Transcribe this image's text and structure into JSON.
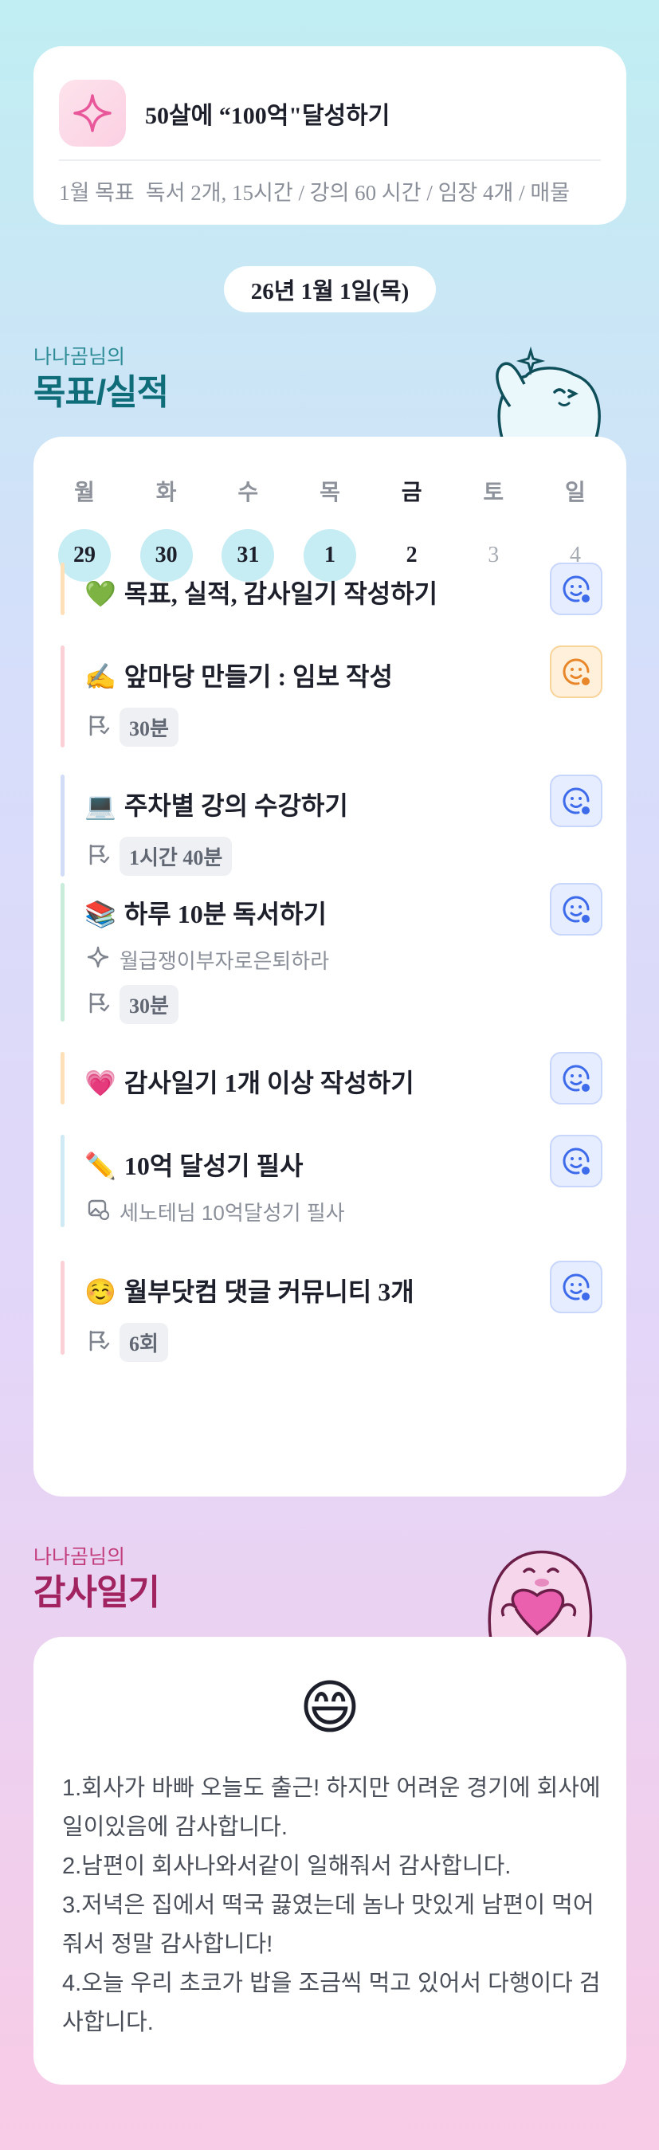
{
  "goal": {
    "title": "50살에 “100억\"달성하기",
    "month_label": "1월 목표",
    "summary": "독서 2개, 15시간 / 강의 60 시간 / 임장 4개 / 매물"
  },
  "date": "26년 1월 1일(목)",
  "goals_section": {
    "owner": "나나곰님의",
    "title": "목표/실적"
  },
  "week": [
    {
      "name": "월",
      "num": "29",
      "state": "done"
    },
    {
      "name": "화",
      "num": "30",
      "state": "done"
    },
    {
      "name": "수",
      "num": "31",
      "state": "done"
    },
    {
      "name": "목",
      "num": "1",
      "state": "done"
    },
    {
      "name": "금",
      "num": "2",
      "state": "today"
    },
    {
      "name": "토",
      "num": "3",
      "state": "future"
    },
    {
      "name": "일",
      "num": "4",
      "state": "future"
    }
  ],
  "tasks": [
    {
      "emoji": "💚",
      "title": "목표, 실적, 감사일기 작성하기",
      "duration": "",
      "note": "",
      "bar_color": "#fde0b8",
      "face": "blue"
    },
    {
      "emoji": "✍️",
      "title": "앞마당 만들기 : 임보 작성",
      "duration": "30분",
      "note": "",
      "bar_color": "#fbd0d6",
      "face": "orange"
    },
    {
      "emoji": "💻",
      "title": "주차별 강의 수강하기",
      "duration": "1시간 40분",
      "note": "",
      "bar_color": "#d1dcf7",
      "face": "blue"
    },
    {
      "emoji": "📚",
      "title": "하루 10분 독서하기",
      "duration": "30분",
      "note": "월급쟁이부자로은퇴하라",
      "bar_color": "#c8ecd9",
      "face": "blue"
    },
    {
      "emoji": "💗",
      "title": "감사일기 1개 이상 작성하기",
      "duration": "",
      "note": "",
      "bar_color": "#fde0b8",
      "face": "blue"
    },
    {
      "emoji": "✏️",
      "title": "10억 달성기 필사",
      "duration": "",
      "note": "세노테님 10억달성기 필사",
      "bar_color": "#cfeaf4",
      "face": "blue"
    },
    {
      "emoji": "☺️",
      "title": "월부닷컴 댓글 커뮤니티 3개",
      "duration": "6회",
      "note": "",
      "bar_color": "#fbd0d6",
      "face": "blue"
    }
  ],
  "gratitude_section": {
    "owner": "나나곰님의",
    "title": "감사일기"
  },
  "gratitude": {
    "emoji": "😄",
    "lines": [
      "1.회사가 바빠 오늘도 출근! 하지만 어려운 경기에 회사에 일이있음에 감사합니다.",
      "2.남편이 회사나와서같이 일해줘서 감사합니다.",
      "3.저녁은 집에서 떡국 끓였는데 놈나 맛있게 남편이 먹어줘서 정말 감사합니다!",
      "4.오늘 우리 초코가 밥을 조금씩 먹고 있어서 다행이다 검사합니다."
    ]
  },
  "colors": {
    "done_day": "#c6ecf4",
    "face_blue": "#3d6bea",
    "face_orange": "#e8872a",
    "teal": "#0f6d79",
    "pink": "#a12360"
  },
  "icons": {
    "goal": "sparkle-icon",
    "status": "smile-face-icon",
    "duration": "flag-icon",
    "book_note": "sparkle-icon",
    "copy_note": "image-icon"
  }
}
